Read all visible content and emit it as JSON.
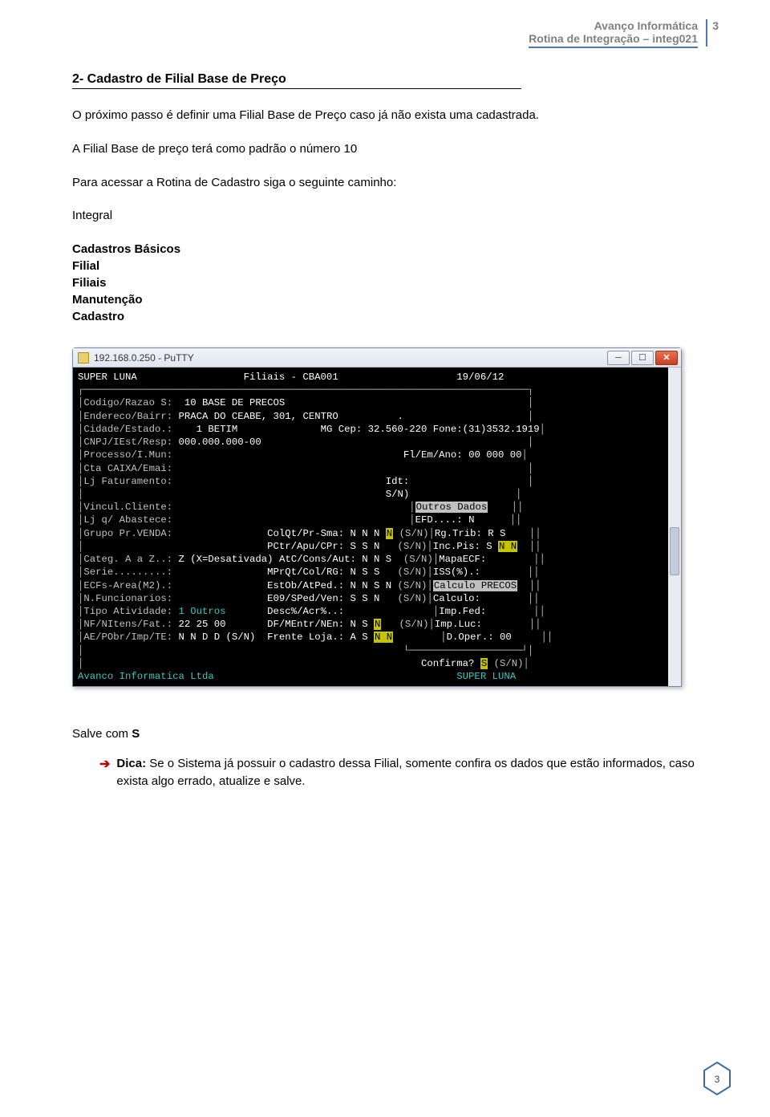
{
  "header": {
    "company": "Avanço Informática",
    "routine": "Rotina de Integração – integ021",
    "page_num_top": "3"
  },
  "section": {
    "title": "2-  Cadastro de Filial Base de Preço",
    "p1": "O próximo passo é definir uma Filial Base de Preço caso já não exista uma cadastrada.",
    "p2": "A Filial Base de preço terá como padrão o número 10",
    "p3": "Para acessar a Rotina de Cadastro siga o seguinte caminho:",
    "p4": "Integral",
    "menu": {
      "l1": "Cadastros Básicos",
      "l2": "Filial",
      "l3": "Filiais",
      "l4": "Manutenção",
      "l5": "Cadastro"
    }
  },
  "putty": {
    "title": "192.168.0.250 - PuTTY"
  },
  "term": {
    "header": {
      "left": "SUPER LUNA",
      "center": "Filiais - CBA001",
      "right": "19/06/12"
    },
    "rows": {
      "r1": {
        "label": "Codigo/Razao S:",
        "val": "  10 BASE DE PRECOS"
      },
      "r2": {
        "label": "Endereco/Bairr:",
        "val": " PRACA DO CEABE, 301, CENTRO          ."
      },
      "r3": {
        "label": "Cidade/Estado.:",
        "val": "    1 BETIM              ",
        "extra": "MG Cep: 32.560-220 Fone:(31)3532.1919"
      },
      "r4": {
        "label": "CNPJ/IEst/Resp:",
        "val": " 000.000.000-00"
      },
      "r5": {
        "label": "Processo/I.Mun:",
        "extra": "Fl/Em/Ano: 00 000 00"
      },
      "r6": {
        "label": "Cta CAIXA/Emai:"
      },
      "r7": {
        "label": "Lj Faturamento:",
        "extra": "Idt:"
      },
      "r8": {
        "extra": "S/N)"
      },
      "r9": {
        "label": "Vincul.Cliente:",
        "box": "Outros Dados"
      },
      "r10": {
        "label": "Lj q/ Abastece:",
        "col3": "EFD....: N"
      },
      "r11": {
        "label": "Grupo Pr.VENDA:",
        "mid": "ColQt/Pr-Sma: N N N",
        "hi": "N",
        "sn": "(S/N)",
        "col3": "Rg.Trib: R S"
      },
      "r12": {
        "mid": "PCtr/Apu/CPr: S S N",
        "sn": "(S/N)",
        "col3a": "Inc.Pis: S ",
        "col3b": "N N"
      },
      "r13": {
        "label": "Categ. A a Z..:",
        "val": " Z (X=Desativada)",
        "mid": "AtC/Cons/Aut: N N S",
        "sn": "(S/N)",
        "col3": "MapaECF:"
      },
      "r14": {
        "label": "Serie.........:",
        "mid": "MPrQt/Col/RG: N S S",
        "sn": "(S/N)",
        "col3": "ISS(%).:"
      },
      "r15": {
        "label": "ECFs-Area(M2).:",
        "mid": "EstOb/AtPed.: N N S N",
        "sn": "(S/N)",
        "box": "Calculo PRECOS"
      },
      "r16": {
        "label": "N.Funcionarios:",
        "mid": "E09/SPed/Ven: S S N",
        "sn": "(S/N)",
        "col3": "Calculo:"
      },
      "r17": {
        "label": "Tipo Atividade:",
        "val": " 1 Outros",
        "mid": "Desc%/Acr%..:",
        "col3": "Imp.Fed:"
      },
      "r18": {
        "label": "NF/NItens/Fat.:",
        "val": " 22 25 00",
        "mid": "DF/MEntr/NEn: N S",
        "hi": "N",
        "sn": "(S/N)",
        "col3": "Imp.Luc:"
      },
      "r19": {
        "label": "AE/PObr/Imp/TE:",
        "val": " N N D D (S/N)",
        "mid": "Frente Loja.: A S",
        "hi": "N N",
        "col3": "D.Oper.: 00"
      },
      "confirm": {
        "text": "Confirma? ",
        "ans": "S",
        "sn": " (S/N)"
      }
    },
    "footer": {
      "left": "Avanco Informatica Ltda",
      "right": "SUPER LUNA"
    }
  },
  "footer_body": {
    "save": "Salve com ",
    "save_key": "S",
    "tip_label": "Dica:",
    "tip_text": " Se o Sistema já possuir o cadastro dessa Filial, somente confira os dados que estão informados, caso exista algo errado, atualize e salve."
  },
  "page_num_bottom": "3"
}
